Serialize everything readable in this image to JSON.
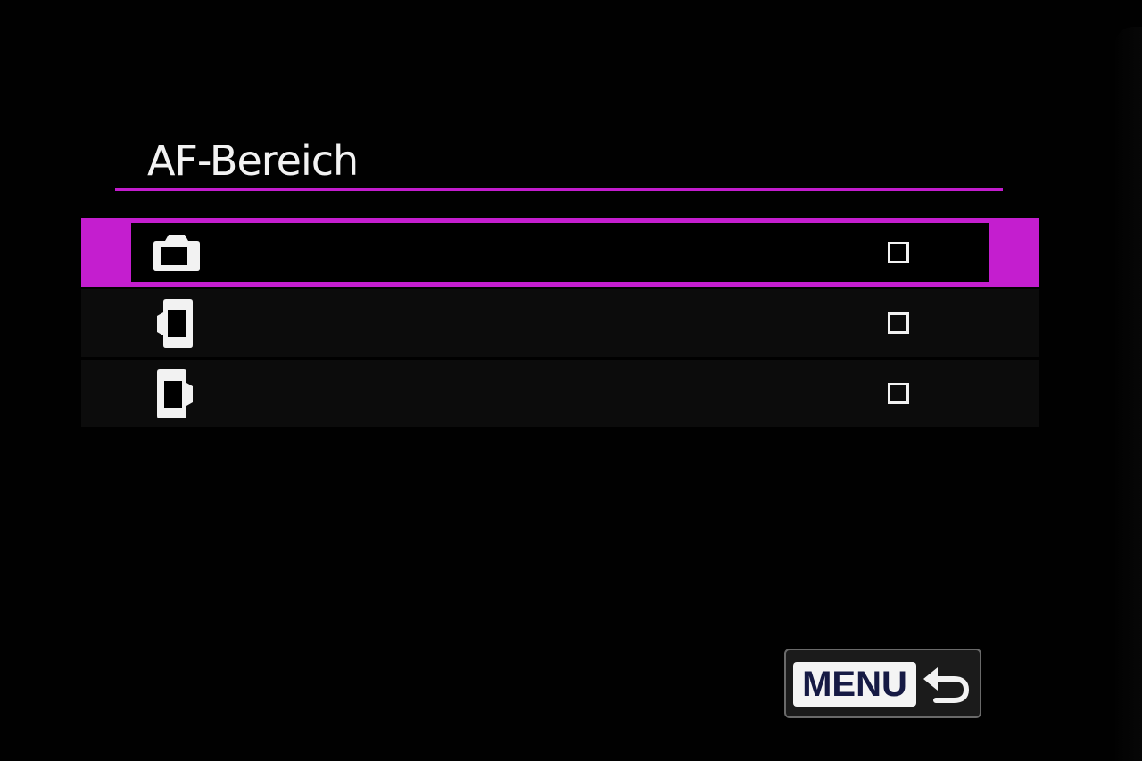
{
  "screen": {
    "title": "AF-Bereich",
    "accent_color": "#c41ecf"
  },
  "options": [
    {
      "icon": "camera-body-icon",
      "checked": false,
      "selected": true
    },
    {
      "icon": "camera-grip-left-icon",
      "checked": false,
      "selected": false
    },
    {
      "icon": "camera-grip-right-icon",
      "checked": false,
      "selected": false
    }
  ],
  "footer": {
    "menu_label": "MENU",
    "back_icon": "return-arrow-icon"
  }
}
